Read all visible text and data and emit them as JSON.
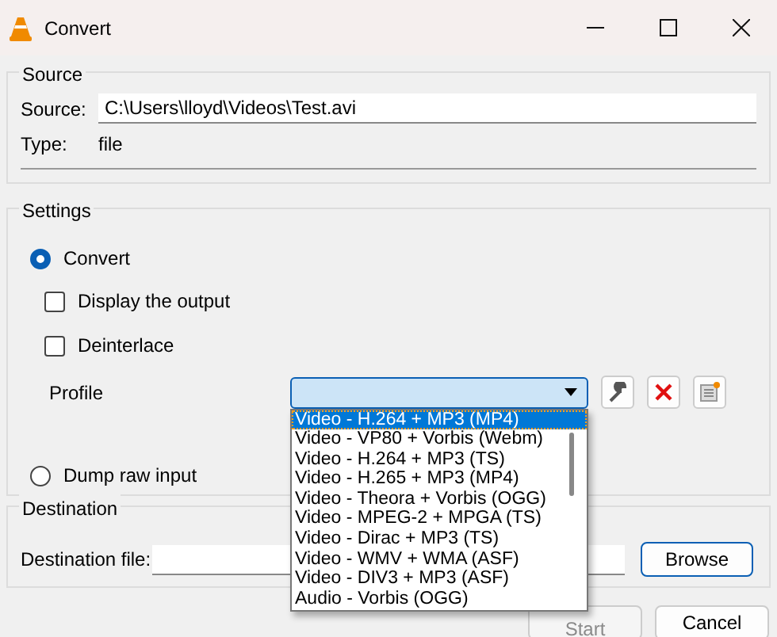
{
  "window": {
    "title": "Convert"
  },
  "source": {
    "title": "Source",
    "source_label": "Source:",
    "source_value": "C:\\Users\\lloyd\\Videos\\Test.avi",
    "type_label": "Type:",
    "type_value": "file"
  },
  "settings": {
    "title": "Settings",
    "convert": {
      "label": "Convert",
      "selected": true
    },
    "checkboxes": [
      {
        "label": "Display the output",
        "checked": false
      },
      {
        "label": "Deinterlace",
        "checked": false
      }
    ],
    "profile_label": "Profile",
    "profile_open": true,
    "profiles": [
      {
        "label": "Video - H.264 + MP3 (MP4)",
        "selected": true
      },
      {
        "label": "Video - VP80 + Vorbis (Webm)",
        "selected": false
      },
      {
        "label": "Video - H.264 + MP3 (TS)",
        "selected": false
      },
      {
        "label": "Video - H.265 + MP3 (MP4)",
        "selected": false
      },
      {
        "label": "Video - Theora + Vorbis (OGG)",
        "selected": false
      },
      {
        "label": "Video - MPEG-2 + MPGA (TS)",
        "selected": false
      },
      {
        "label": "Video - Dirac + MP3 (TS)",
        "selected": false
      },
      {
        "label": "Video - WMV + WMA (ASF)",
        "selected": false
      },
      {
        "label": "Video - DIV3 + MP3 (ASF)",
        "selected": false
      },
      {
        "label": "Audio - Vorbis (OGG)",
        "selected": false
      }
    ],
    "dump_raw": {
      "label": "Dump raw input",
      "selected": false
    }
  },
  "destination": {
    "title": "Destination",
    "file_label": "Destination file:",
    "browse": "Browse"
  },
  "buttons": [
    {
      "label": "Start",
      "disabled": true
    },
    {
      "label": "Cancel",
      "disabled": false
    }
  ]
}
